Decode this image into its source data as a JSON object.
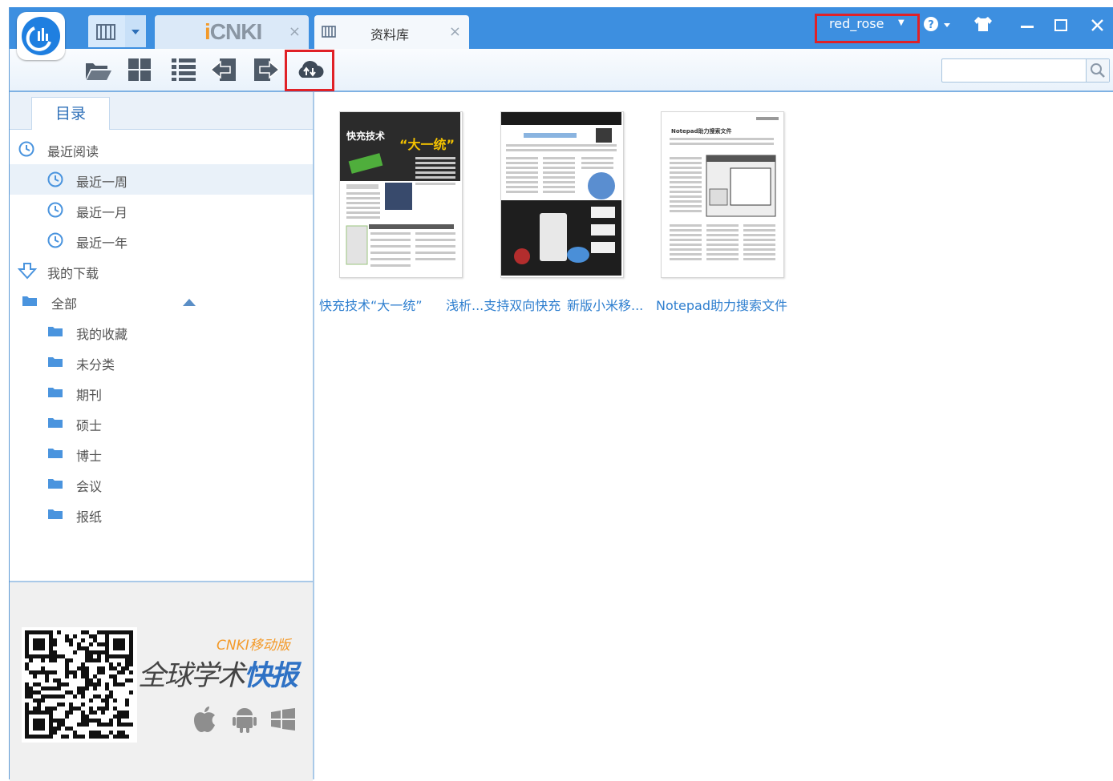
{
  "titlebar": {
    "tabs": [
      {
        "label": "",
        "brand": "cnki",
        "close": "×"
      },
      {
        "label": "资料库",
        "close": "×"
      }
    ],
    "user": "red_rose",
    "help_icon": "question-icon",
    "skin_icon": "shirt-icon",
    "minimize": "—",
    "maximize": "☐",
    "close": "✕"
  },
  "toolbar": {
    "buttons": [
      "open-folder-icon",
      "grid-view-icon",
      "list-view-icon",
      "back-icon",
      "forward-icon",
      "cloud-sync-icon"
    ],
    "search_placeholder": ""
  },
  "sidebar": {
    "tab": "目录",
    "items": [
      {
        "label": "最近阅读",
        "icon": "clock-icon"
      },
      {
        "label": "最近一周",
        "icon": "clock-icon",
        "selected": true
      },
      {
        "label": "最近一月",
        "icon": "clock-icon"
      },
      {
        "label": "最近一年",
        "icon": "clock-icon"
      },
      {
        "label": "我的下载",
        "icon": "download-icon"
      },
      {
        "label": "全部",
        "icon": "folder-icon"
      },
      {
        "label": "我的收藏",
        "icon": "folder-icon"
      },
      {
        "label": "未分类",
        "icon": "folder-icon"
      },
      {
        "label": "期刊",
        "icon": "folder-icon"
      },
      {
        "label": "硕士",
        "icon": "folder-icon"
      },
      {
        "label": "博士",
        "icon": "folder-icon"
      },
      {
        "label": "会议",
        "icon": "folder-icon"
      },
      {
        "label": "报纸",
        "icon": "folder-icon"
      }
    ],
    "promo": {
      "brand_small": "CNKI移动版",
      "headline_a": "全球学术",
      "headline_b": "快报",
      "platforms": [
        "apple-icon",
        "android-icon",
        "windows-icon"
      ]
    }
  },
  "documents": [
    {
      "title": "快充技术“大一统”",
      "cover_heading": "快充技术",
      "cover_sub": "“大一统”"
    },
    {
      "title": "浅析...支持双向快充",
      "cover_heading": ""
    },
    {
      "title": "新版小米移...",
      "cover_heading": ""
    },
    {
      "title": "Notepad助力搜索文件",
      "cover_heading": "Notepad助力搜索文件"
    }
  ],
  "colors": {
    "accent": "#3d8fe0",
    "highlight": "#e02127",
    "link": "#2f7fcf",
    "promo_orange": "#f39a2a"
  }
}
